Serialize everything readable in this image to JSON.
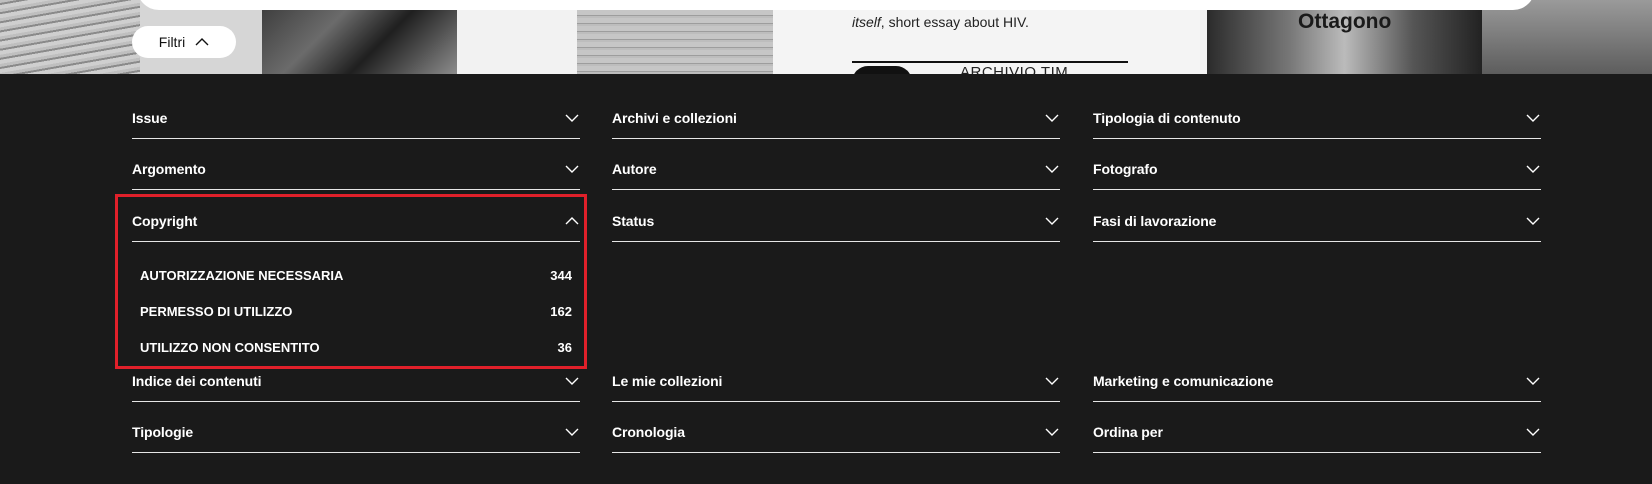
{
  "hero": {
    "essay_italic": "itself",
    "essay_rest": ", short essay about HIV.",
    "archivio": "ARCHIVIO TIM",
    "ottagono": "Ottagono"
  },
  "filtri_label": "Filtri",
  "filters": {
    "issue": "Issue",
    "archivi": "Archivi e collezioni",
    "tipologia_contenuto": "Tipologia di contenuto",
    "argomento": "Argomento",
    "autore": "Autore",
    "fotografo": "Fotografo",
    "copyright": "Copyright",
    "status": "Status",
    "fasi": "Fasi di lavorazione",
    "indice": "Indice dei contenuti",
    "collezioni": "Le mie collezioni",
    "marketing": "Marketing e comunicazione",
    "tipologie": "Tipologie",
    "cronologia": "Cronologia",
    "ordina": "Ordina per"
  },
  "copyright_options": [
    {
      "label": "AUTORIZZAZIONE NECESSARIA",
      "count": "344"
    },
    {
      "label": "PERMESSO DI UTILIZZO",
      "count": "162"
    },
    {
      "label": "UTILIZZO NON CONSENTITO",
      "count": "36"
    }
  ],
  "colors": {
    "background": "#1a1a1a",
    "highlight": "#e0202a"
  }
}
